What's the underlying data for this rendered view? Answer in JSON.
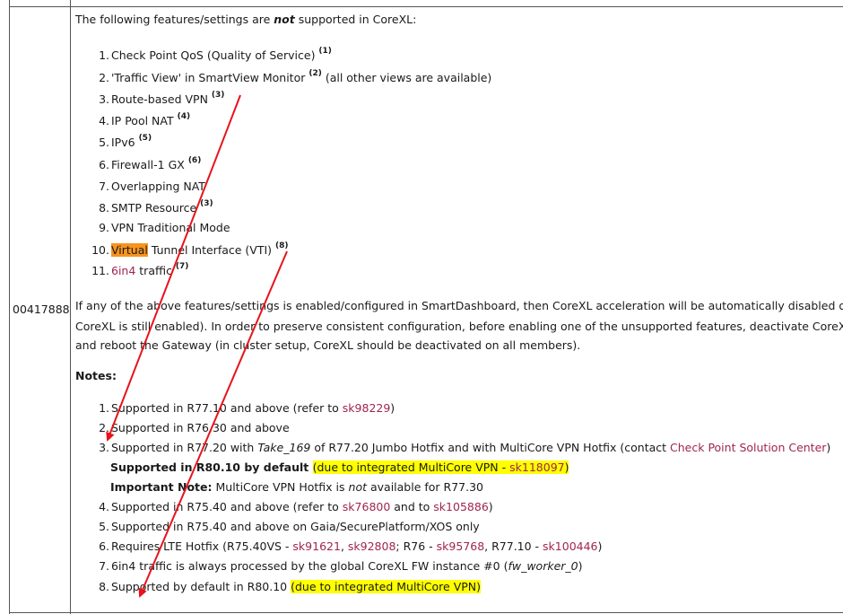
{
  "row_id": "00417888",
  "intro_prefix": "The following features/settings are ",
  "intro_emph": "not",
  "intro_suffix": " supported in CoreXL:",
  "features": [
    {
      "num": "1.",
      "text": "Check Point QoS (Quality of Service) ",
      "sup": "(1)"
    },
    {
      "num": "2.",
      "text": "'Traffic View' in SmartView Monitor ",
      "sup": "(2)",
      "after": " (all other views are available)"
    },
    {
      "num": "3.",
      "text": "Route-based VPN ",
      "sup": "(3)"
    },
    {
      "num": "4.",
      "text": "IP Pool NAT ",
      "sup": "(4)"
    },
    {
      "num": "5.",
      "text": "IPv6 ",
      "sup": "(5)"
    },
    {
      "num": "6.",
      "text": "Firewall-1 GX ",
      "sup": "(6)"
    },
    {
      "num": "7.",
      "text": "Overlapping NAT"
    },
    {
      "num": "8.",
      "text": "SMTP Resource ",
      "sup": "(3)"
    },
    {
      "num": "9.",
      "text": "VPN Traditional Mode"
    },
    {
      "num": "10.",
      "hl": "Virtual",
      "text": " Tunnel Interface (VTI) ",
      "sup": "(8)"
    },
    {
      "num": "11.",
      "link": "6in4",
      "text": " traffic ",
      "sup": "(7)"
    }
  ],
  "paragraph": [
    "If any of the above features/settings is enabled/configured in SmartDashboard, then CoreXL acceleration will be automatically disabled on t",
    "CoreXL is still enabled). In order to preserve consistent configuration, before enabling one of the unsupported features, deactivate CoreXL v",
    "and reboot the Gateway (in cluster setup, CoreXL should be deactivated on all members)."
  ],
  "notes_label": "Notes:",
  "notes": {
    "n1": {
      "num": "1.",
      "text": "Supported in R77.10 and above (refer to ",
      "link": "sk98229",
      "after": ")"
    },
    "n2": {
      "num": "2.",
      "text": "Supported in R76.30 and above"
    },
    "n3": {
      "num": "3.",
      "text": "Supported in R77.20 with ",
      "em": "Take_169",
      "text2": " of R77.20 Jumbo Hotfix and with MultiCore VPN Hotfix (contact ",
      "link": "Check Point Solution Center",
      "after": ")"
    },
    "n3a_bold": "Supported in R80.10 by default ",
    "n3a_hl1": "(due to integrated MultiCore VPN - ",
    "n3a_link": "sk118097",
    "n3a_hl2": ")",
    "n3b_bold": "Important Note:",
    "n3b_text": " MultiCore VPN Hotfix is ",
    "n3b_em": "not",
    "n3b_after": " available for R77.30",
    "n4": {
      "num": "4.",
      "text": "Supported in R75.40 and above (refer to ",
      "link1": "sk76800",
      "mid": " and to ",
      "link2": "sk105886",
      "after": ")"
    },
    "n5": {
      "num": "5.",
      "text": "Supported in R75.40 and above on Gaia/SecurePlatform/XOS only"
    },
    "n6": {
      "num": "6.",
      "text": "Requires LTE Hotfix (R75.40VS - ",
      "l1": "sk91621",
      "s1": ", ",
      "l2": "sk92808",
      "s2": "; R76 - ",
      "l3": "sk95768",
      "s3": ", R77.10 - ",
      "l4": "sk100446",
      "after": ")"
    },
    "n7": {
      "num": "7.",
      "text": "6in4 traffic is always processed by the global CoreXL FW instance #0 (",
      "em": "fw_worker_0",
      "after": ")"
    },
    "n8": {
      "num": "8.",
      "text": "Supported by default in R80.10 ",
      "hl": "(due to integrated MultiCore VPN)"
    }
  }
}
